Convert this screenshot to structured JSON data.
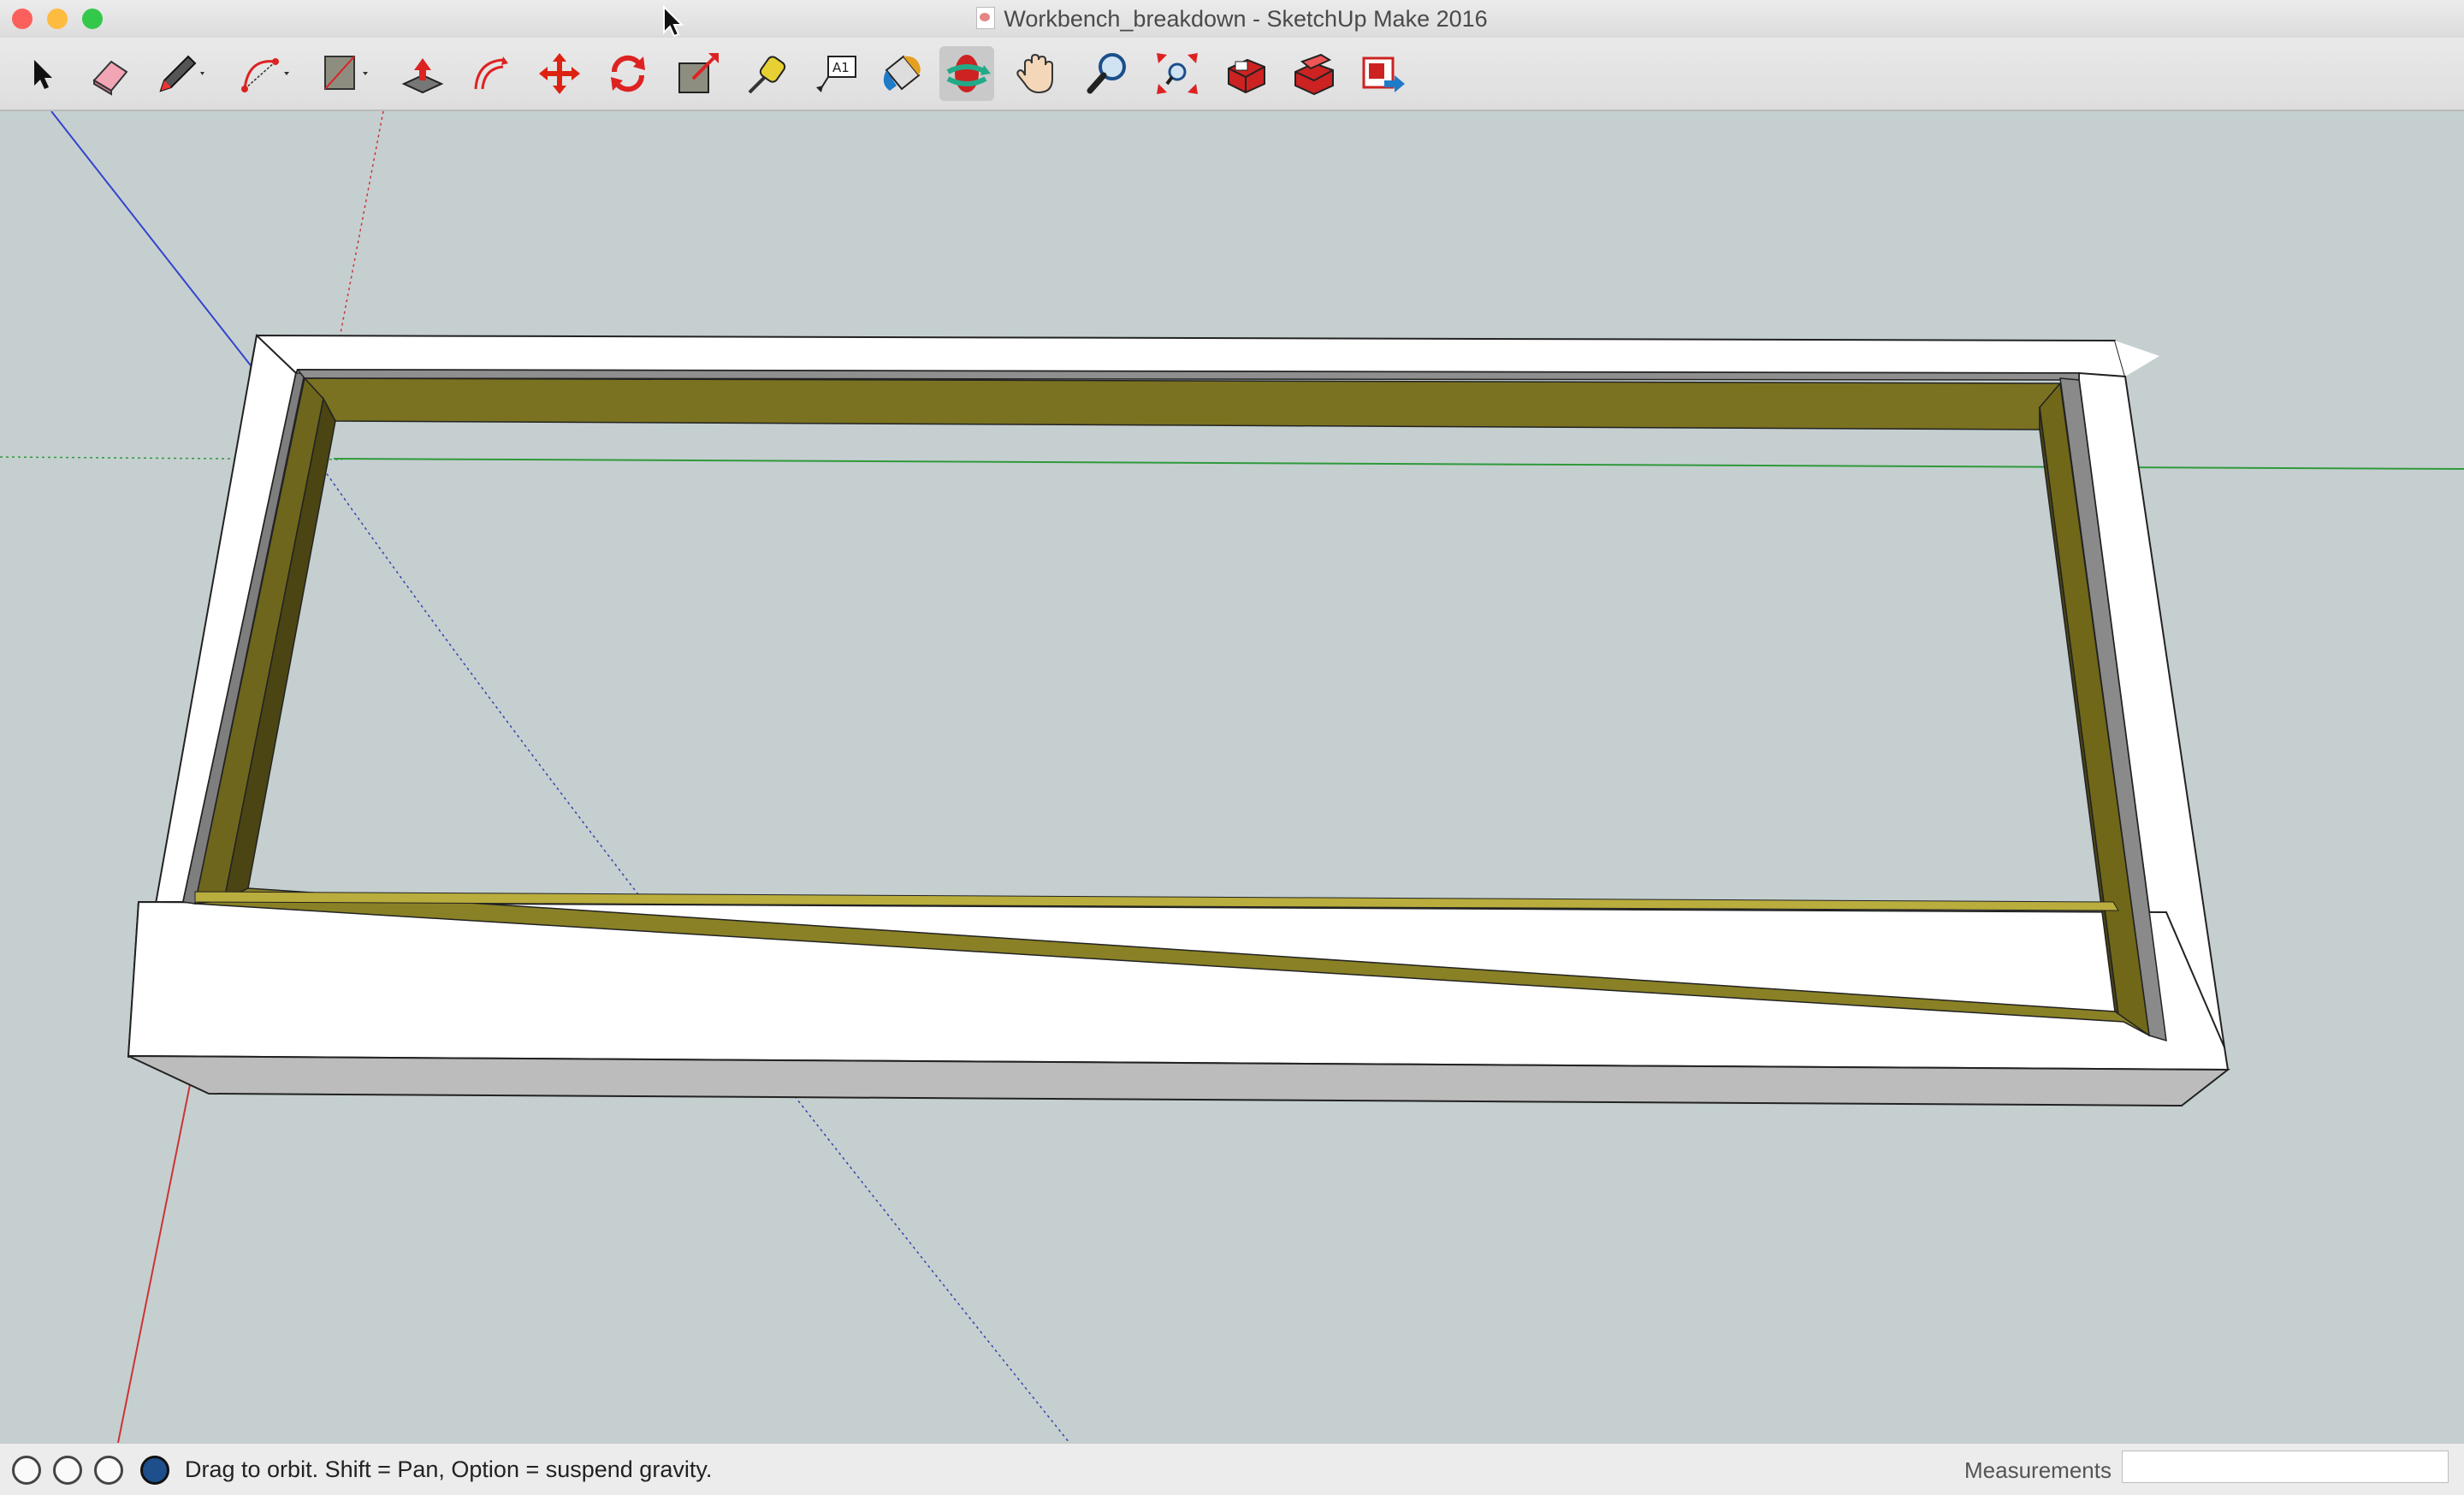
{
  "window": {
    "title": "Workbench_breakdown - SketchUp Make 2016",
    "traffic_lights": [
      {
        "name": "close",
        "color": "#fc605c"
      },
      {
        "name": "minimize",
        "color": "#fdbc40"
      },
      {
        "name": "zoom",
        "color": "#34c84a"
      }
    ]
  },
  "toolbar": {
    "tools": [
      {
        "name": "select-tool",
        "icon": "arrow-cursor-icon"
      },
      {
        "name": "eraser-tool",
        "icon": "eraser-icon"
      },
      {
        "name": "line-tool",
        "icon": "pencil-icon",
        "dropdown": true
      },
      {
        "name": "arc-tool",
        "icon": "arc-icon",
        "dropdown": true
      },
      {
        "name": "rectangle-tool",
        "icon": "rectangle-icon",
        "dropdown": true
      },
      {
        "name": "push-pull-tool",
        "icon": "push-pull-icon"
      },
      {
        "name": "offset-tool",
        "icon": "offset-icon"
      },
      {
        "name": "move-tool",
        "icon": "move-arrows-icon"
      },
      {
        "name": "rotate-tool",
        "icon": "rotate-icon"
      },
      {
        "name": "scale-tool",
        "icon": "scale-icon"
      },
      {
        "name": "tape-measure-tool",
        "icon": "tape-measure-icon"
      },
      {
        "name": "text-tool",
        "icon": "text-label-icon"
      },
      {
        "name": "paint-bucket-tool",
        "icon": "paint-bucket-icon"
      },
      {
        "name": "orbit-tool",
        "icon": "orbit-icon",
        "active": true
      },
      {
        "name": "pan-tool",
        "icon": "hand-icon"
      },
      {
        "name": "zoom-tool",
        "icon": "magnifier-icon"
      },
      {
        "name": "zoom-extents-tool",
        "icon": "zoom-extents-icon"
      },
      {
        "name": "warehouse-tool",
        "icon": "3d-warehouse-icon"
      },
      {
        "name": "extension-warehouse-tool",
        "icon": "extension-warehouse-icon"
      },
      {
        "name": "share-model-tool",
        "icon": "share-model-icon"
      }
    ]
  },
  "status": {
    "icons": [
      "geo-location-icon",
      "credits-info-icon",
      "user-account-icon",
      "help-icon"
    ],
    "message": "Drag to orbit. Shift = Pan, Option = suspend gravity.",
    "measurements_label": "Measurements",
    "measurements_value": ""
  },
  "colors": {
    "viewport_bg": "#c5cfd0",
    "board_white": "#ffffff",
    "board_grey": "#b8b8b8",
    "wood_inner": "#7a7220",
    "axis_red": "#cc3333",
    "axis_green": "#2f9a3a",
    "axis_blue": "#3344cc"
  }
}
